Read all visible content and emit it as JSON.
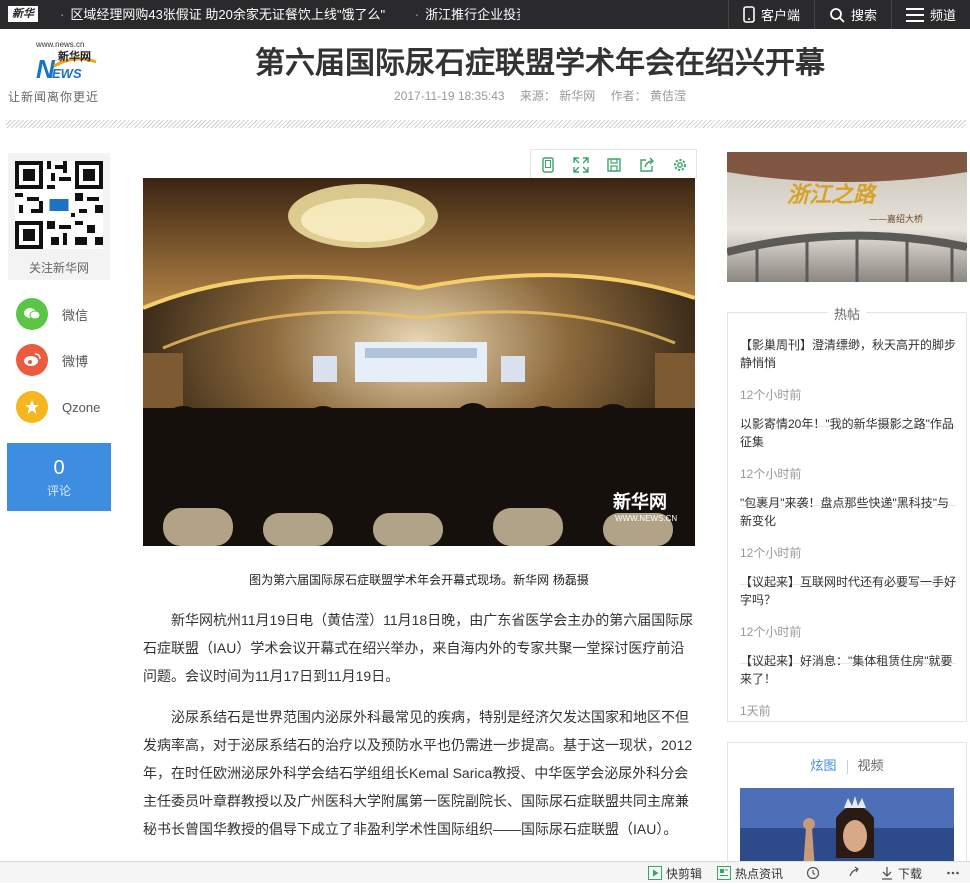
{
  "topbar": {
    "logo_text": "新华",
    "ticker": [
      "区域经理网购43张假证 助20余家无证餐饮上线\"饿了么\"",
      "浙江推行企业投资项目"
    ],
    "nav": {
      "client": "客户端",
      "search": "搜索",
      "channel": "频道"
    }
  },
  "header": {
    "logo_url_text": "www.news.cn",
    "logo_name": "新华网",
    "logo_slogan": "让新闻离你更近",
    "title": "第六届国际尿石症联盟学术年会在绍兴开幕",
    "date": "2017-11-19 18:35:43",
    "source": "来源： 新华网",
    "author": "作者： 黄佶滢"
  },
  "share": {
    "qr_label": "关注新华网",
    "wechat": "微信",
    "weibo": "微博",
    "qzone": "Qzone",
    "comment_count": "0",
    "comment_label": "评论"
  },
  "article": {
    "photo_watermark": "新华网",
    "photo_watermark_url": "WWW.NEWS.CN",
    "caption": "图为第六届国际尿石症联盟学术年会开幕式现场。新华网 杨磊摄",
    "paragraphs": [
      "新华网杭州11月19日电（黄佶滢）11月18日晚，由广东省医学会主办的第六届国际尿石症联盟（IAU）学术会议开幕式在绍兴举办，来自海内外的专家共聚一堂探讨医疗前沿问题。会议时间为11月17日到11月19日。",
      "泌尿系结石是世界范围内泌尿外科最常见的疾病，特别是经济欠发达国家和地区不但发病率高，对于泌尿系结石的治疗以及预防水平也仍需进一步提高。基于这一现状，2012年，在时任欧洲泌尿外科学会结石学组组长Kemal Sarica教授、中华医学会泌尿外科分会主任委员叶章群教授以及广州医科大学附属第一医院副院长、国际尿石症联盟共同主席兼秘书长曾国华教授的倡导下成立了非盈利学术性国际组织——国际尿石症联盟（IAU）。"
    ]
  },
  "sidebar": {
    "banner_title": "浙江之路",
    "banner_sub": "——嘉绍大桥",
    "hot_title": "热帖",
    "hot_items": [
      {
        "title": "【影巢周刊】澄清缥缈，秋天高开的脚步静悄悄",
        "time": "12个小时前"
      },
      {
        "title": "以影寄情20年！\"我的新华摄影之路\"作品征集",
        "time": "12个小时前"
      },
      {
        "title": "\"包裹月\"来袭！盘点那些快递\"黑科技\"与新变化",
        "time": "12个小时前"
      },
      {
        "title": "【议起来】互联网时代还有必要写一手好字吗？",
        "time": "12个小时前"
      },
      {
        "title": "【议起来】好消息：\"集体租赁住房\"就要来了！",
        "time": "1天前"
      }
    ],
    "gallery_tabs": [
      "炫图",
      "视频"
    ]
  },
  "bottombar": {
    "quick_edit": "快剪辑",
    "hot_news": "热点资讯",
    "download": "下载"
  },
  "colors": {
    "accent": "#3d8de0",
    "wechat": "#5bc645",
    "weibo": "#ec5a3f",
    "qzone": "#f5b71d",
    "topbar": "#2a2a2c"
  }
}
